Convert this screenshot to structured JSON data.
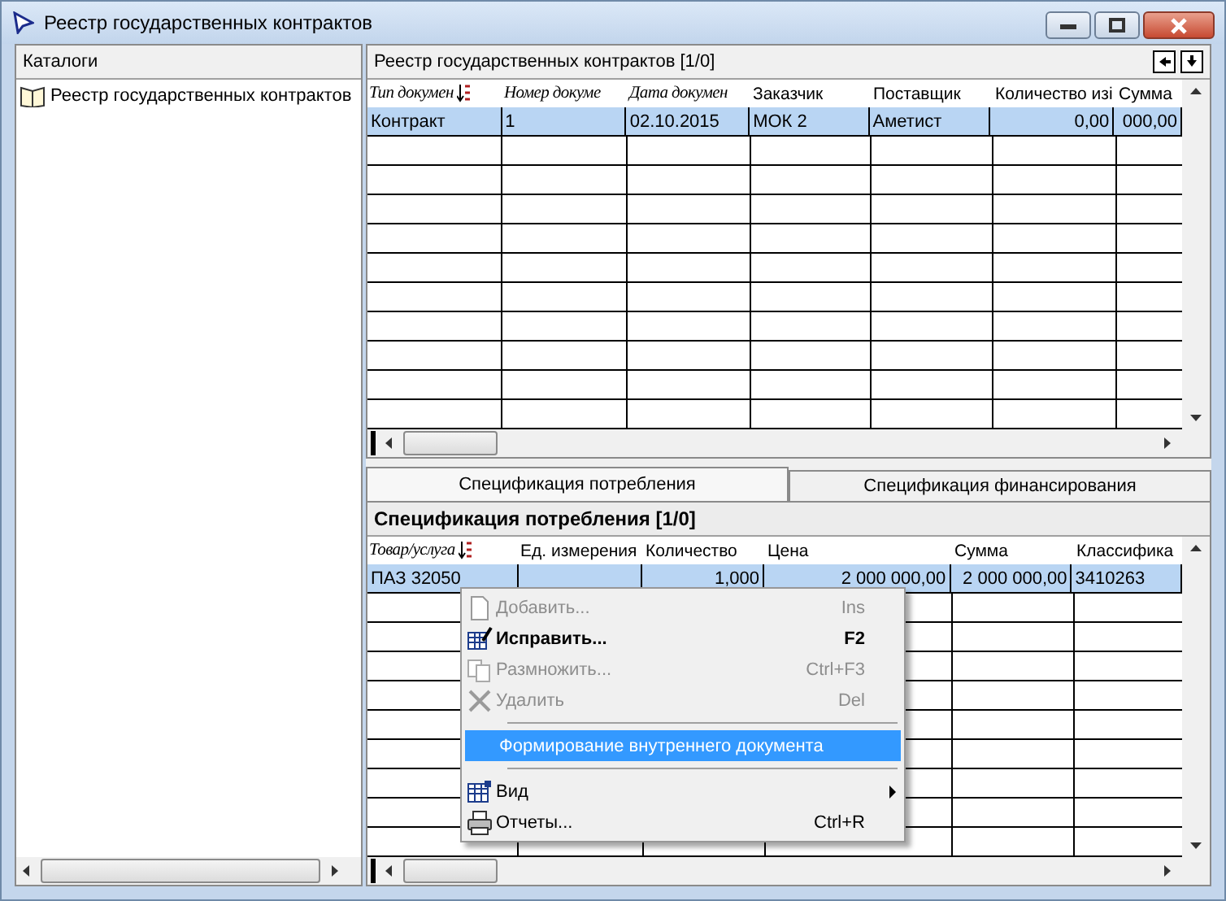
{
  "window": {
    "title": "Реестр государственных контрактов"
  },
  "catalogs": {
    "title": "Каталоги",
    "items": [
      {
        "label": "Реестр государственных контрактов"
      }
    ]
  },
  "registry": {
    "title": "Реестр государственных контрактов [1/0]",
    "columns": [
      {
        "label": "Тип докумен",
        "kind": "italic",
        "sorted": true
      },
      {
        "label": "Номер докуме",
        "kind": "italic",
        "sorted": false
      },
      {
        "label": "Дата докумен",
        "kind": "italic",
        "sorted": false
      },
      {
        "label": "Заказчик",
        "kind": "plain",
        "sorted": false
      },
      {
        "label": "Поставщик",
        "kind": "plain",
        "sorted": false
      },
      {
        "label": "Количество изі",
        "kind": "number",
        "sorted": false
      },
      {
        "label": "Сумма",
        "kind": "number",
        "sorted": false
      }
    ],
    "rows": [
      {
        "selected": true,
        "cells": [
          "Контракт",
          "1",
          "02.10.2015",
          "МОК 2",
          "Аметист",
          "0,00",
          "000,00"
        ]
      }
    ]
  },
  "tabs": [
    {
      "label": "Спецификация потребления",
      "selected": true
    },
    {
      "label": "Спецификация финансирования",
      "selected": false
    }
  ],
  "spec": {
    "title": "Спецификация потребления [1/0]",
    "columns": [
      {
        "label": "Товар/услуга",
        "kind": "italic",
        "sorted": true
      },
      {
        "label": "Ед. измерения",
        "kind": "plain",
        "sorted": false
      },
      {
        "label": "Количество",
        "kind": "number",
        "sorted": false
      },
      {
        "label": "Цена",
        "kind": "number",
        "sorted": false
      },
      {
        "label": "Сумма",
        "kind": "number",
        "sorted": false
      },
      {
        "label": "Классифика",
        "kind": "plain",
        "sorted": false
      }
    ],
    "rows": [
      {
        "selected": true,
        "cells": [
          "ПАЗ 32050",
          "",
          "1,000",
          "2 000 000,00",
          "2 000 000,00",
          "3410263"
        ]
      }
    ]
  },
  "context_menu": [
    {
      "kind": "item",
      "label": "Добавить...",
      "shortcut": "Ins",
      "disabled": true,
      "default": false,
      "selected": false,
      "submenu": false
    },
    {
      "kind": "item",
      "label": "Исправить...",
      "shortcut": "F2",
      "disabled": false,
      "default": true,
      "selected": false,
      "submenu": false
    },
    {
      "kind": "item",
      "label": "Размножить...",
      "shortcut": "Ctrl+F3",
      "disabled": true,
      "default": false,
      "selected": false,
      "submenu": false
    },
    {
      "kind": "item",
      "label": "Удалить",
      "shortcut": "Del",
      "disabled": true,
      "default": false,
      "selected": false,
      "submenu": false
    },
    {
      "kind": "separator"
    },
    {
      "kind": "item",
      "label": "Формирование внутреннего документа",
      "disabled": false,
      "default": false,
      "selected": true,
      "submenu": false
    },
    {
      "kind": "separator"
    },
    {
      "kind": "item",
      "label": "Вид",
      "disabled": false,
      "default": false,
      "selected": false,
      "submenu": true
    },
    {
      "kind": "item",
      "label": "Отчеты...",
      "shortcut": "Ctrl+R",
      "disabled": false,
      "default": false,
      "selected": false,
      "submenu": false
    }
  ]
}
